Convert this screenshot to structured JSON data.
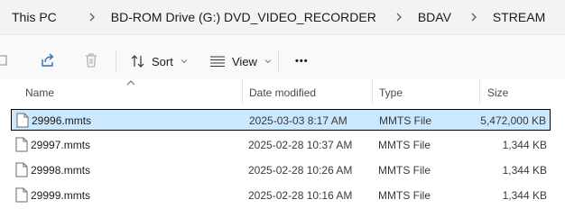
{
  "breadcrumb": {
    "items": [
      "This PC",
      "BD-ROM Drive (G:) DVD_VIDEO_RECORDER",
      "BDAV",
      "STREAM"
    ]
  },
  "toolbar": {
    "sort_label": "Sort",
    "view_label": "View",
    "more_label": "•••"
  },
  "columns": {
    "name": "Name",
    "date_modified": "Date modified",
    "type": "Type",
    "size": "Size"
  },
  "files": [
    {
      "name": "29996.mmts",
      "date": "2025-03-03 8:17 AM",
      "type": "MMTS File",
      "size": "5,472,000 KB",
      "selected": true
    },
    {
      "name": "29997.mmts",
      "date": "2025-02-28 10:37 AM",
      "type": "MMTS File",
      "size": "1,344 KB",
      "selected": false
    },
    {
      "name": "29998.mmts",
      "date": "2025-02-28 10:26 AM",
      "type": "MMTS File",
      "size": "1,344 KB",
      "selected": false
    },
    {
      "name": "29999.mmts",
      "date": "2025-02-28 10:16 AM",
      "type": "MMTS File",
      "size": "1,344 KB",
      "selected": false
    }
  ],
  "icons": {
    "crumb_separator": "chevron-right-icon",
    "file": "file-icon",
    "share": "share-icon",
    "delete": "trash-icon",
    "sort": "sort-arrows-icon",
    "view": "view-lines-icon",
    "rename": "rename-icon"
  },
  "colors": {
    "selection_fill": "#cce8ff",
    "selection_border": "#000000",
    "breadcrumb_bg": "#f3f3f3",
    "cmdbar_bg": "#f9f9f9"
  }
}
